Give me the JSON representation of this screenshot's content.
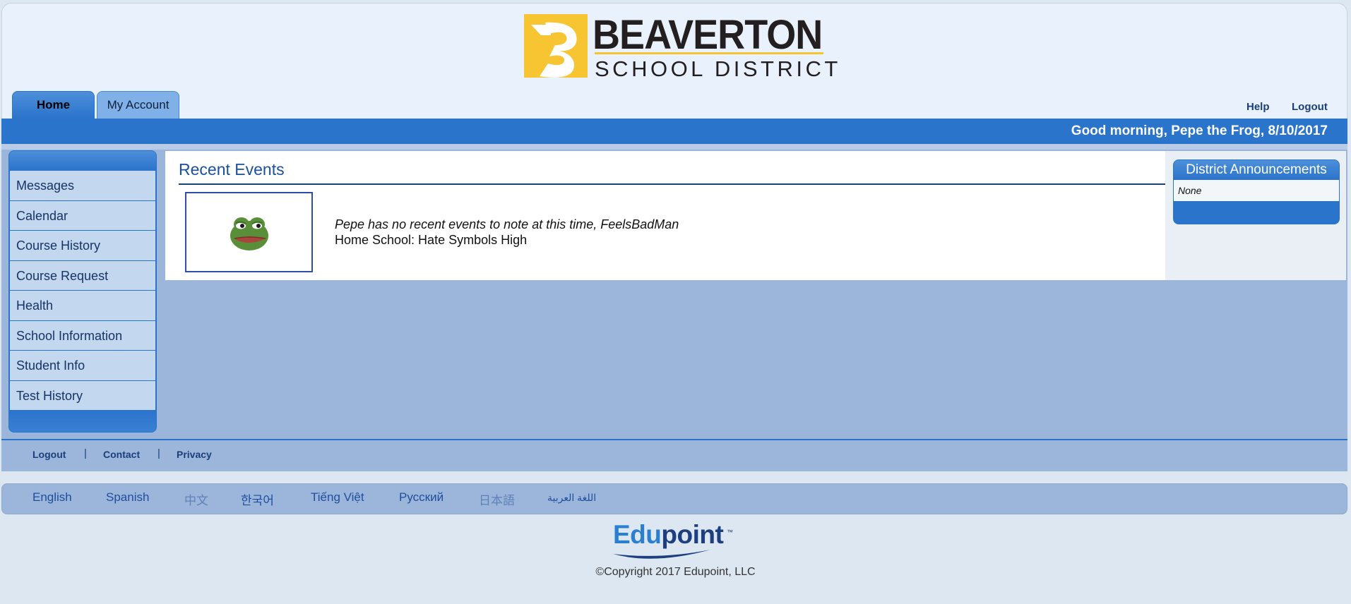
{
  "header": {
    "logo_title": "BEAVERTON",
    "logo_subtitle": "SCHOOL DISTRICT"
  },
  "tabs": [
    {
      "label": "Home",
      "active": true
    },
    {
      "label": "My Account",
      "active": false
    }
  ],
  "top_links": {
    "help": "Help",
    "logout": "Logout"
  },
  "greeting": "Good morning, Pepe the Frog, 8/10/2017",
  "sidebar": {
    "items": [
      {
        "label": "Messages"
      },
      {
        "label": "Calendar"
      },
      {
        "label": "Course History"
      },
      {
        "label": "Course Request"
      },
      {
        "label": "Health"
      },
      {
        "label": "School Information"
      },
      {
        "label": "Student Info"
      },
      {
        "label": "Test History"
      }
    ]
  },
  "main": {
    "title": "Recent Events",
    "event_message": "Pepe has no recent events to note at this time, FeelsBadMan",
    "home_school": "Home School: Hate Symbols High"
  },
  "announcements": {
    "title": "District Announcements",
    "body": "None"
  },
  "footer": {
    "links": [
      "Logout",
      "Contact",
      "Privacy"
    ],
    "separator": "|"
  },
  "languages": [
    "English",
    "Spanish",
    "中文",
    "한국어",
    "Tiếng Việt",
    "Русский",
    "日本語",
    "اللغة العربية"
  ],
  "brand": {
    "edu": "Edu",
    "point": "point",
    "tm": "™"
  },
  "copyright": "©Copyright 2017 Edupoint, LLC",
  "colors": {
    "accent_blue": "#2b74cc",
    "sidebar_item": "#c3d8ef",
    "logo_yellow": "#f7c432"
  }
}
